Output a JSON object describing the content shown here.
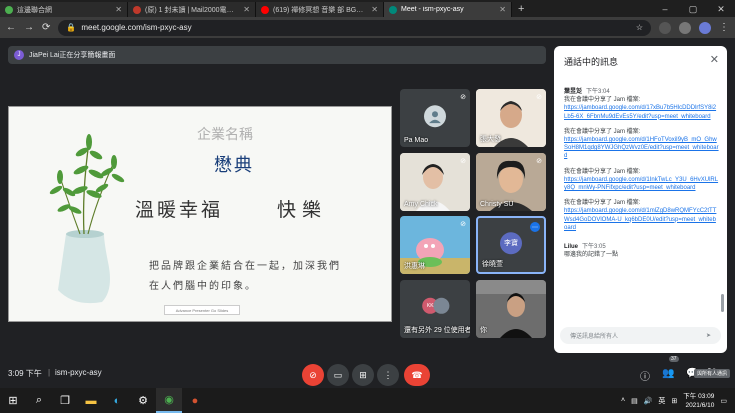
{
  "tabs": [
    {
      "label": "這邊聯合網",
      "color": "#4caf50",
      "active": false
    },
    {
      "label": "(原) 1 封未讀 | Mail2000電子信...",
      "color": "#c0392b",
      "active": false
    },
    {
      "label": "(619) 禪修冥想 音樂 部 BGM...",
      "color": "#ff0000",
      "active": false
    },
    {
      "label": "Meet - ism-pxyc-asy",
      "color": "#00897b",
      "active": true
    }
  ],
  "new_tab": "+",
  "window": {
    "minimize": "–",
    "maximize": "▢",
    "close": "✕"
  },
  "address": {
    "url": "meet.google.com/ism-pxyc-asy"
  },
  "banner": {
    "avatar": "J",
    "text": "JiaPei Lai正在分享簡報畫面"
  },
  "slide": {
    "company": "企業名稱",
    "logo": "懋典",
    "slogan1": "溫暖幸福",
    "slogan2": "快樂",
    "body1": "把品牌跟企業結合在一起，加深我們",
    "body2": "在人們腦中的印象。",
    "presenter_bar": "Advance Presenter Go Slides"
  },
  "participants": [
    {
      "name": "Pa Mao",
      "bg": "#3c4043"
    },
    {
      "name": "張大發",
      "bg": "#f0ebe3"
    },
    {
      "name": "Amy Chick",
      "bg": "#e8e4dc"
    },
    {
      "name": "Christy SU",
      "bg": "#c7b6a5"
    },
    {
      "name": "洪惠琳",
      "bg": "#7fbfe0"
    },
    {
      "name": "徐曉萱",
      "initials": "李寶",
      "bg": "#3c4043"
    },
    {
      "name": "還有另外 29 位使用者",
      "initials": "KK",
      "bg": "#3c4043"
    },
    {
      "name": "你",
      "bg": "#5a5a5a"
    }
  ],
  "bottom": {
    "time": "3:09 下午",
    "separator": "|",
    "meeting_code": "ism-pxyc-asy",
    "participant_count": "37",
    "tooltip": "與所有人通訊"
  },
  "chat": {
    "title": "通話中的訊息",
    "messages": [
      {
        "sender": "葉昱彣",
        "time": "下午3:04",
        "lines": [
          "我在會議中分享了 Jam 檔案:"
        ],
        "link": "https://jamboard.google.com/d/17xBu7b5HlcDDDlrfSY8i2Lb5-6X_6FbnMu9dEvEs5Y/edit?usp=meet_whiteboard"
      },
      {
        "sender": "",
        "time": "",
        "lines": [
          "我在會議中分享了 Jam 檔案:"
        ],
        "link": "https://jamboard.google.com/d/1HFoTVoxiI9yB_mO_GhwSoH8M1qdg8YWJGhQzWvz0E/edit?usp=meet_whiteboard"
      },
      {
        "sender": "",
        "time": "",
        "lines": [
          "我在會議中分享了 Jam 檔案:"
        ],
        "link": "https://jamboard.google.com/d/1InkTwLc_Y3U_6HvXUlRLy8Q_mnWy-PNFifxpc/edit?usp=meet_whiteboard"
      },
      {
        "sender": "",
        "time": "",
        "lines": [
          "我在會議中分享了 Jam 檔案:"
        ],
        "link": "https://jamboard.google.com/d/1mlZgD8wRQMFYcC2tTTWsd4GoDOVlOMA-U_kq6bDE0U/edit?usp=meet_whiteboard"
      },
      {
        "sender": "Lilue",
        "time": "下午3:05",
        "lines": [
          "哪邊我的記錯了一點"
        ],
        "link": ""
      }
    ],
    "input_placeholder": "傳送訊息給所有人",
    "send_icon": "send-icon"
  },
  "taskbar": {
    "tray_text": "英",
    "clock_time": "下午 03:09",
    "clock_date": "2021/6/10"
  }
}
